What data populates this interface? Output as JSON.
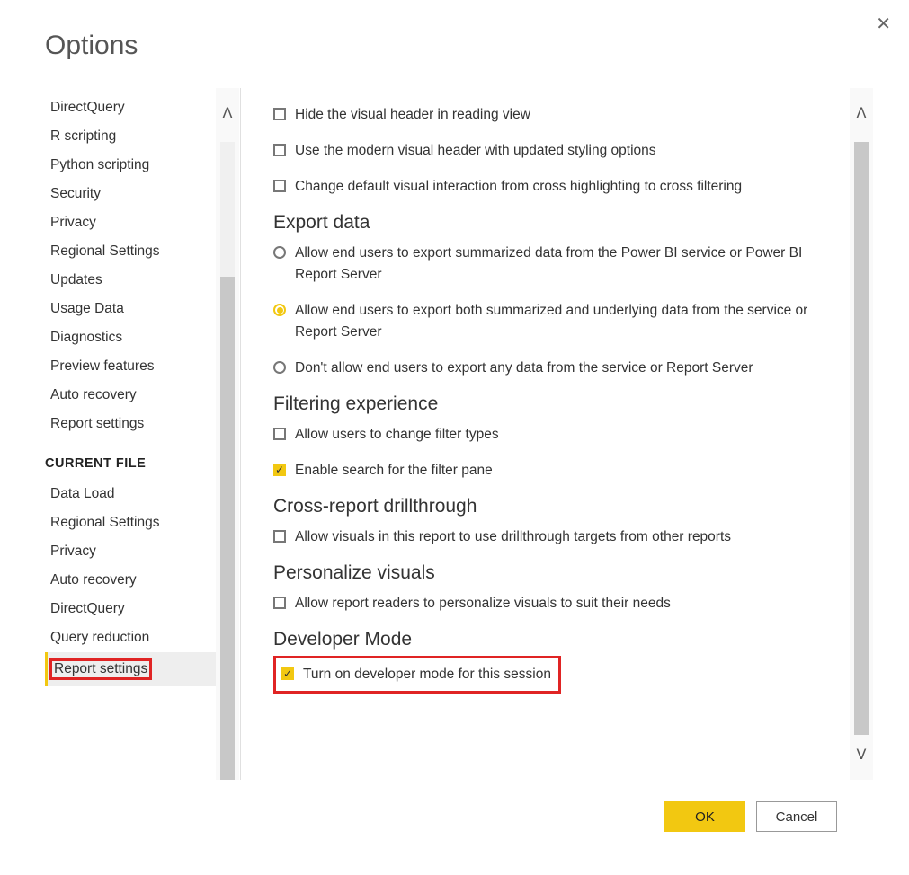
{
  "title": "Options",
  "colors": {
    "accent": "#F2C811",
    "highlight": "#e02424"
  },
  "sidebar": {
    "global_items": [
      "DirectQuery",
      "R scripting",
      "Python scripting",
      "Security",
      "Privacy",
      "Regional Settings",
      "Updates",
      "Usage Data",
      "Diagnostics",
      "Preview features",
      "Auto recovery",
      "Report settings"
    ],
    "section_header": "CURRENT FILE",
    "file_items": [
      "Data Load",
      "Regional Settings",
      "Privacy",
      "Auto recovery",
      "DirectQuery",
      "Query reduction",
      "Report settings"
    ],
    "selected_index": 6
  },
  "content": {
    "visual_options": [
      "Hide the visual header in reading view",
      "Use the modern visual header with updated styling options",
      "Change default visual interaction from cross highlighting to cross filtering"
    ],
    "export": {
      "title": "Export data",
      "options": [
        "Allow end users to export summarized data from the Power BI service or Power BI Report Server",
        "Allow end users to export both summarized and underlying data from the service or Report Server",
        "Don't allow end users to export any data from the service or Report Server"
      ],
      "selected": 1
    },
    "filtering": {
      "title": "Filtering experience",
      "options": [
        {
          "label": "Allow users to change filter types",
          "checked": false
        },
        {
          "label": "Enable search for the filter pane",
          "checked": true
        }
      ]
    },
    "drillthrough": {
      "title": "Cross-report drillthrough",
      "option": "Allow visuals in this report to use drillthrough targets from other reports",
      "checked": false
    },
    "personalize": {
      "title": "Personalize visuals",
      "option": "Allow report readers to personalize visuals to suit their needs",
      "checked": false
    },
    "developer": {
      "title": "Developer Mode",
      "option": "Turn on developer mode for this session",
      "checked": true
    }
  },
  "footer": {
    "ok": "OK",
    "cancel": "Cancel"
  }
}
